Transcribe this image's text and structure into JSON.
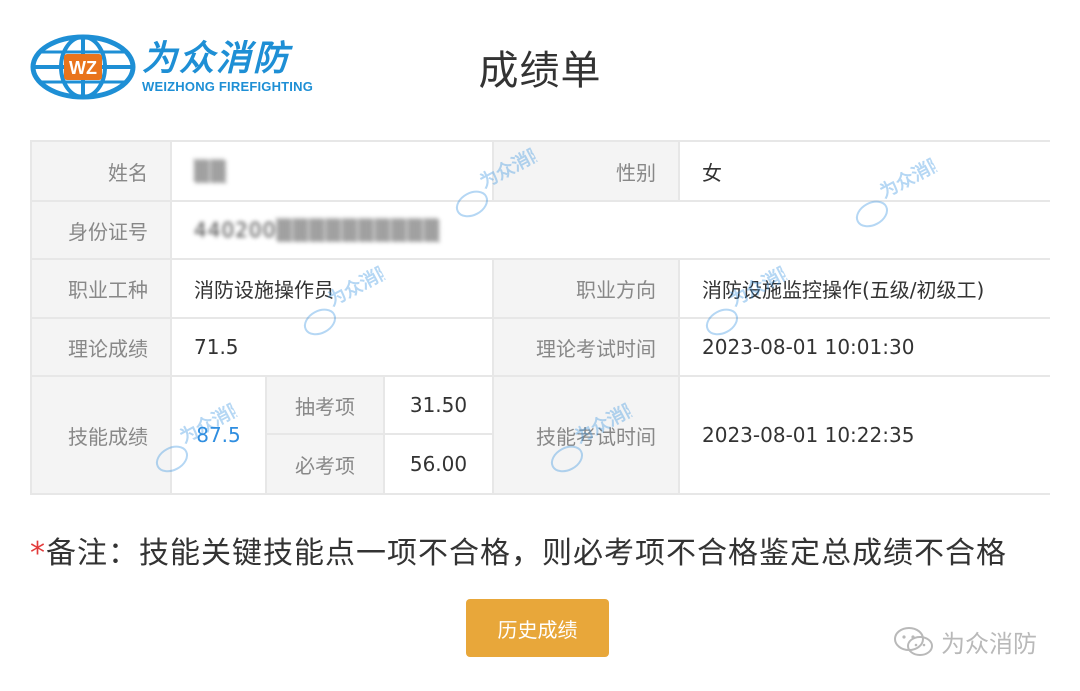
{
  "logo": {
    "badge": "WZ",
    "name_cn": "为众消防",
    "name_en": "WEIZHONG FIREFIGHTING"
  },
  "page_title": "成绩单",
  "watermark_text": "为众消防",
  "table": {
    "name_label": "姓名",
    "name_value": "▒▒",
    "gender_label": "性别",
    "gender_value": "女",
    "id_label": "身份证号",
    "id_value": "440200▒▒▒▒▒▒▒▒▒▒",
    "occupation_label": "职业工种",
    "occupation_value": "消防设施操作员",
    "direction_label": "职业方向",
    "direction_value": "消防设施监控操作(五级/初级工)",
    "theory_score_label": "理论成绩",
    "theory_score_value": "71.5",
    "theory_time_label": "理论考试时间",
    "theory_time_value": "2023-08-01 10:01:30",
    "skill_score_label": "技能成绩",
    "skill_score_value": "87.5",
    "sampled_label": "抽考项",
    "sampled_value": "31.50",
    "required_label": "必考项",
    "required_value": "56.00",
    "skill_time_label": "技能考试时间",
    "skill_time_value": "2023-08-01 10:22:35"
  },
  "note": {
    "star": "*",
    "text": "备注：技能关键技能点一项不合格，则必考项不合格鉴定总成绩不合格"
  },
  "history_button": "历史成绩",
  "footer_brand": "为众消防",
  "colors": {
    "brand_blue": "#1e8fd5",
    "button_orange": "#e8a73a",
    "link_blue": "#2f8ee0",
    "note_star_red": "#e23b3b"
  }
}
